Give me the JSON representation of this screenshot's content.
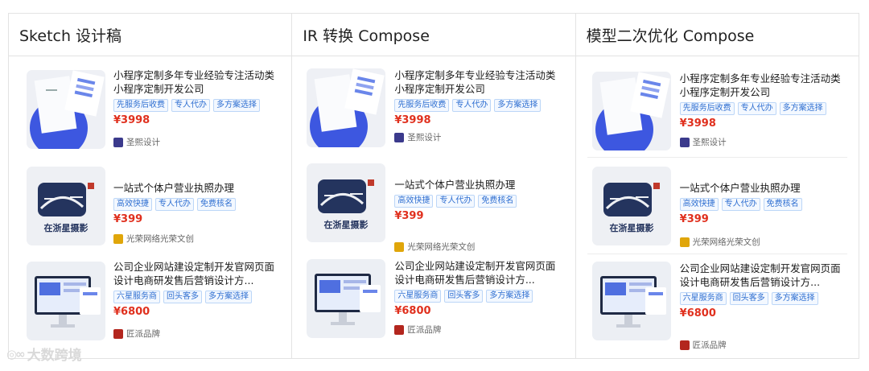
{
  "columns": [
    {
      "header": "Sketch 设计稿",
      "items": [
        {
          "title": "小程序定制多年专业经验专注活动类小程序定制开发公司",
          "tags": [
            "先服务后收费",
            "专人代办",
            "多方案选择"
          ],
          "price": "¥3998",
          "shop": "圣熙设计"
        },
        {
          "title": "一站式个体户营业执照办理",
          "tags": [
            "高效快捷",
            "专人代办",
            "免费核名"
          ],
          "price": "¥399",
          "shop": "光荣网络光荣文创"
        },
        {
          "title": "公司企业网站建设定制开发官网页面设计电商研发售后营销设计方...",
          "tags": [
            "六星服务商",
            "回头客多",
            "多方案选择"
          ],
          "price": "¥6800",
          "shop": "匠派品牌"
        }
      ]
    },
    {
      "header": "IR 转换 Compose",
      "items": [
        {
          "title": "小程序定制多年专业经验专注活动类小程序定制开发公司",
          "tags": [
            "先服务后收费",
            "专人代办",
            "多方案选择"
          ],
          "price": "¥3998",
          "shop": "圣熙设计"
        },
        {
          "title": "一站式个体户营业执照办理",
          "tags": [
            "高效快捷",
            "专人代办",
            "免费核名"
          ],
          "price": "¥399",
          "shop": "光荣网络光荣文创"
        },
        {
          "title": "公司企业网站建设定制开发官网页面设计电商研发售后营销设计方...",
          "tags": [
            "六星服务商",
            "回头客多",
            "多方案选择"
          ],
          "price": "¥6800",
          "shop": "匠派品牌"
        }
      ]
    },
    {
      "header": "模型二次优化 Compose",
      "items": [
        {
          "title": "小程序定制多年专业经验专注活动类小程序定制开发公司",
          "tags": [
            "先服务后收费",
            "专人代办",
            "多方案选择"
          ],
          "price": "¥3998",
          "shop": "圣熙设计"
        },
        {
          "title": "一站式个体户营业执照办理",
          "tags": [
            "高效快捷",
            "专人代办",
            "免费核名"
          ],
          "price": "¥399",
          "shop": "光荣网络光荣文创"
        },
        {
          "title": "公司企业网站建设定制开发官网页面设计电商研发售后营销设计方...",
          "tags": [
            "六星服务商",
            "回头客多",
            "多方案选择"
          ],
          "price": "¥6800",
          "shop": "匠派品牌"
        }
      ]
    }
  ],
  "logo_text": "在浙星摄影",
  "watermark": "大数跨境",
  "colors": {
    "price": "#e0301e",
    "tag_text": "#2f6fd1",
    "tag_border": "#bcd6f7",
    "border": "#e3e3e3"
  },
  "icons": {
    "shop_1": "studio-logo-icon",
    "shop_2": "license-logo-icon",
    "shop_3": "brand-logo-icon",
    "watermark": "weibo-icon"
  }
}
